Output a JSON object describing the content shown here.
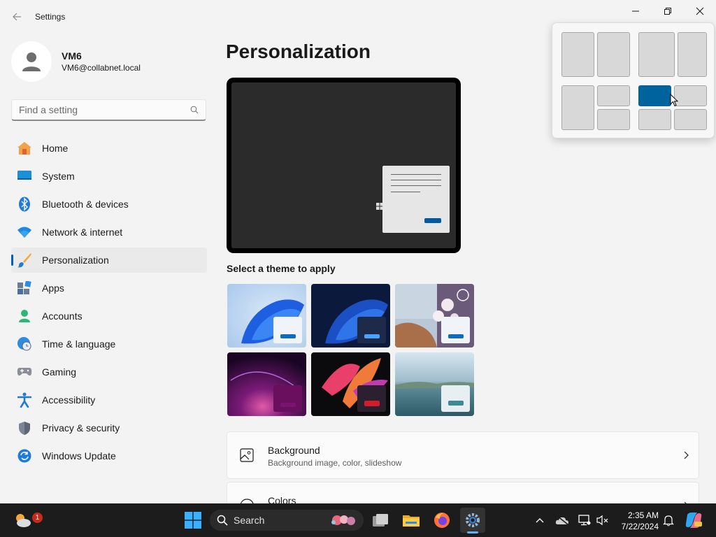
{
  "window": {
    "title": "Settings"
  },
  "user": {
    "name": "VM6",
    "email": "VM6@collabnet.local"
  },
  "search": {
    "placeholder": "Find a setting"
  },
  "sidebar": {
    "items": [
      {
        "label": "Home",
        "icon": "home-icon"
      },
      {
        "label": "System",
        "icon": "system-icon"
      },
      {
        "label": "Bluetooth & devices",
        "icon": "bluetooth-icon"
      },
      {
        "label": "Network & internet",
        "icon": "wifi-icon"
      },
      {
        "label": "Personalization",
        "icon": "brush-icon",
        "active": true
      },
      {
        "label": "Apps",
        "icon": "apps-icon"
      },
      {
        "label": "Accounts",
        "icon": "accounts-icon"
      },
      {
        "label": "Time & language",
        "icon": "globe-clock-icon"
      },
      {
        "label": "Gaming",
        "icon": "gamepad-icon"
      },
      {
        "label": "Accessibility",
        "icon": "accessibility-icon"
      },
      {
        "label": "Privacy & security",
        "icon": "shield-icon"
      },
      {
        "label": "Windows Update",
        "icon": "update-icon"
      }
    ]
  },
  "main": {
    "title": "Personalization",
    "themes_label": "Select a theme to apply",
    "cards": [
      {
        "title": "Background",
        "subtitle": "Background image, color, slideshow",
        "icon": "picture-icon"
      },
      {
        "title": "Colors",
        "subtitle": "",
        "icon": "palette-icon"
      }
    ]
  },
  "snap_layouts": {
    "selected_zone": "layout-4 top-left"
  },
  "taskbar": {
    "search_label": "Search",
    "time": "2:35 AM",
    "date": "7/22/2024",
    "weather_badge": "1"
  },
  "colors": {
    "accent": "#005fb8",
    "snap_selected": "#00639c",
    "taskbar": "#1c1c1c"
  }
}
